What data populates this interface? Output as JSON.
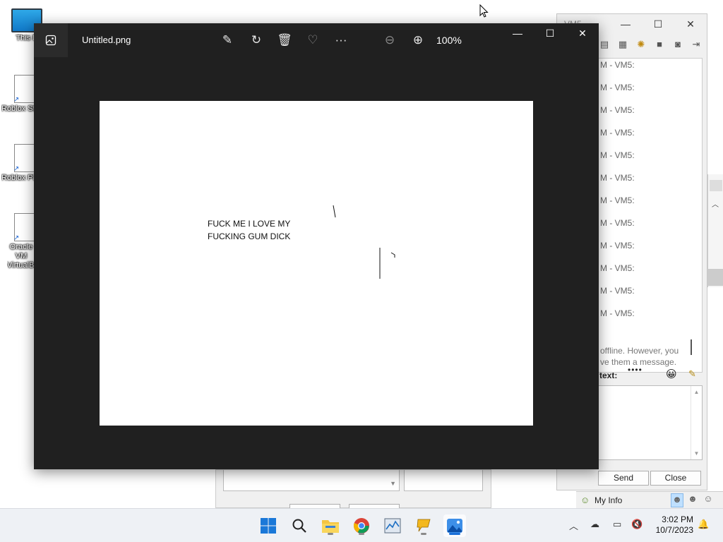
{
  "desktop": {
    "icons": [
      {
        "label": "This PC"
      },
      {
        "label": "Roblox Studio"
      },
      {
        "label": "Roblox Player"
      },
      {
        "label": "Oracle VM VirtualBox"
      }
    ]
  },
  "chat_window": {
    "title": "VM5 ...",
    "log_lines": [
      "M - VM5:",
      "M - VM5:",
      "M - VM5:",
      "M - VM5:",
      "M - VM5:",
      "M - VM5:",
      "M - VM5:",
      "M - VM5:",
      "M - VM5:",
      "M - VM5:",
      "M - VM5:",
      "M - VM5:"
    ],
    "offline_notice": "offline. However, you ve them a message.",
    "text_label": "text:",
    "send_label": "Send",
    "close_label": "Close",
    "my_info_label": "My Info"
  },
  "bottom_window": {
    "button1": "Send",
    "button2": "Close"
  },
  "viewer": {
    "filename": "Untitled.png",
    "zoom": "100%",
    "image_text_line1": "FUCK ME I LOVE MY",
    "image_text_line2": "FUCKING GUM DICK",
    "icons": [
      "edit-image-icon",
      "rotate-icon",
      "delete-icon",
      "favorite-icon",
      "more-icon",
      "zoom-out-icon",
      "zoom-in-icon"
    ]
  },
  "taskbar": {
    "time": "3:02 PM",
    "date": "10/7/2023",
    "apps": [
      "start-icon",
      "search-icon",
      "file-explorer-icon",
      "chrome-icon",
      "task-manager-icon",
      "chat-app-icon",
      "photos-icon"
    ]
  },
  "colors": {
    "viewer_bg": "#202020",
    "taskbar_bg": "#eef1f5",
    "accent": "#1a6fd8"
  }
}
